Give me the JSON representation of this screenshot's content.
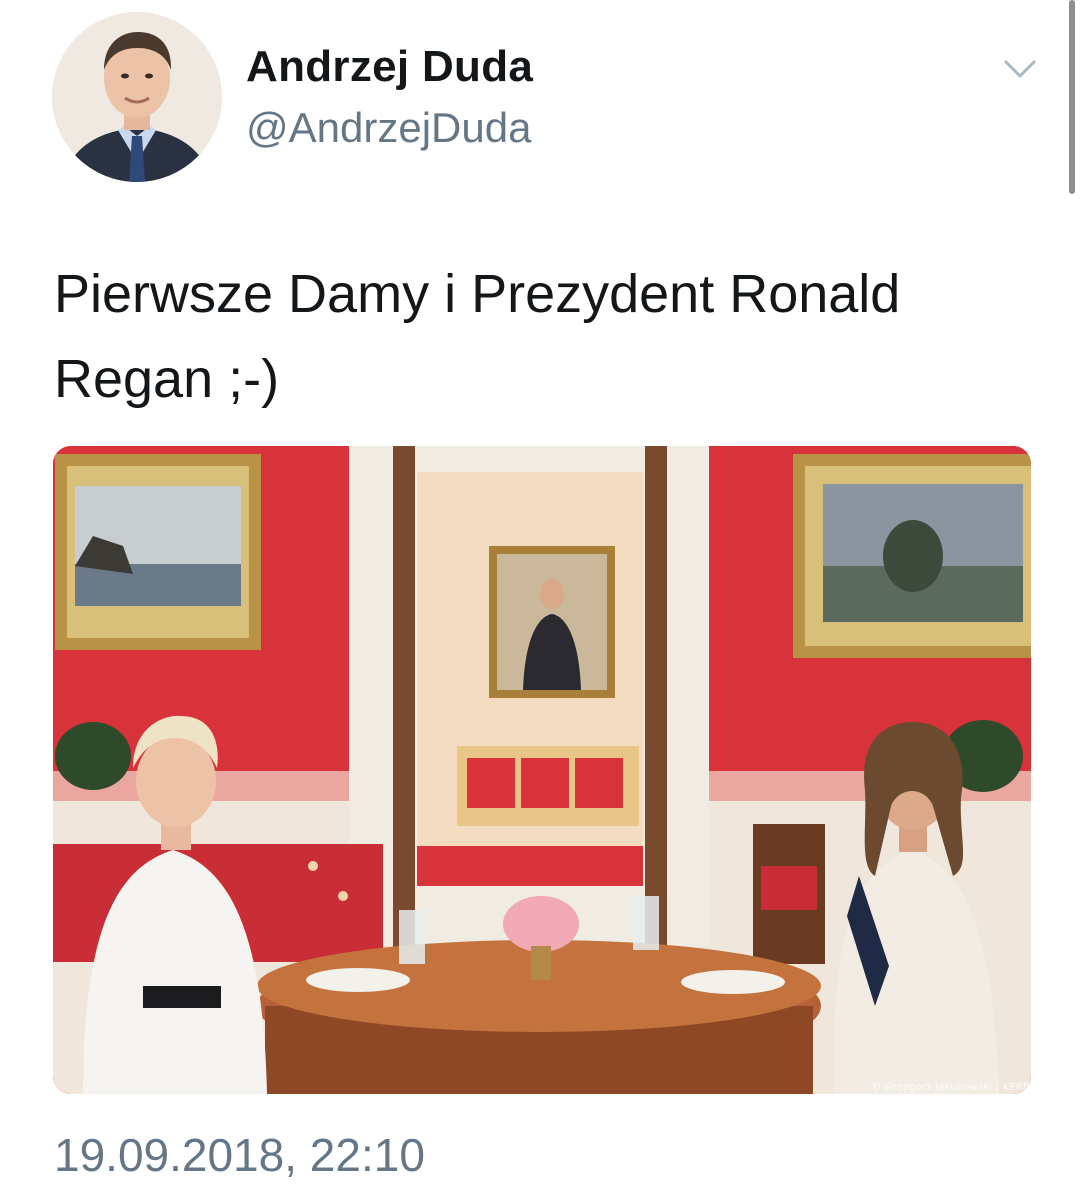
{
  "author": {
    "display_name": "Andrzej Duda",
    "handle": "@AndrzejDuda",
    "avatar_icon": "profile-photo"
  },
  "tweet": {
    "text": "Pierwsze Damy i Prezydent Ronald Regan ;-)",
    "timestamp": "19.09.2018, 22:10"
  },
  "media": {
    "watermark": "© Grzegorz Jakubowski / KPRP"
  },
  "menu": {
    "icon": "chevron-down-icon"
  },
  "colors": {
    "text_primary": "#14171a",
    "text_secondary": "#657786",
    "room_red": "#d8333a"
  }
}
